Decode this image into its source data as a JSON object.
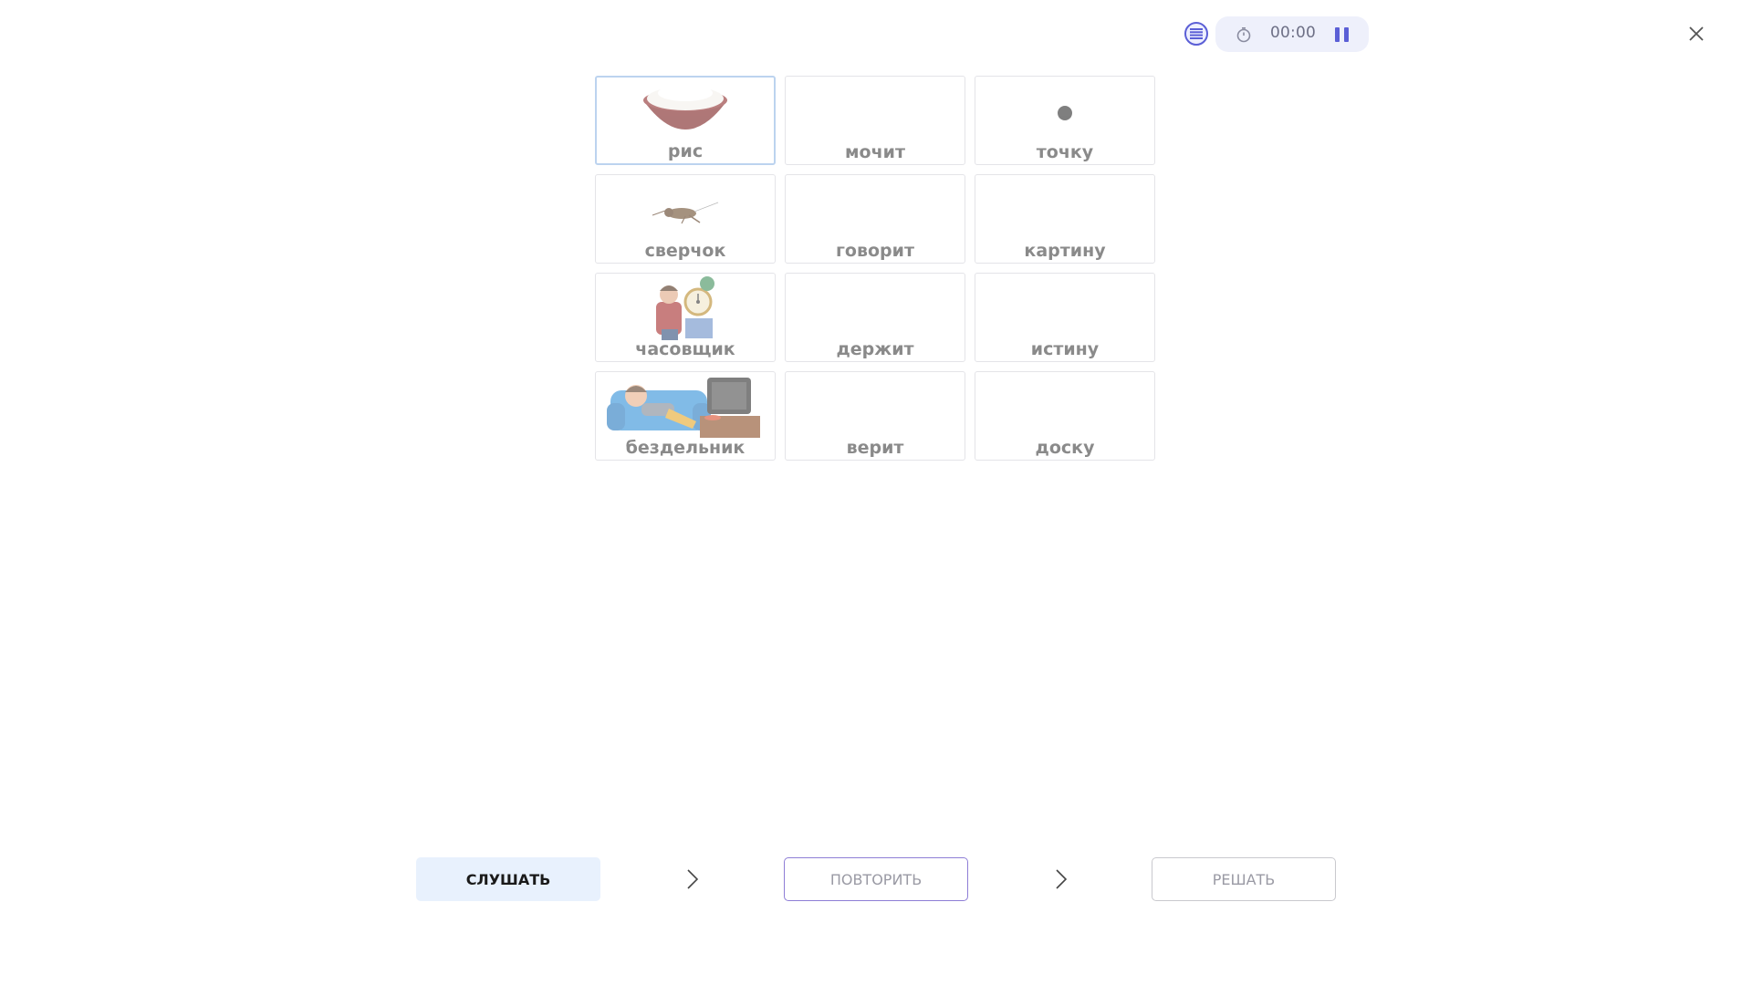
{
  "header": {
    "timer": "00:00"
  },
  "grid": {
    "rows": [
      [
        {
          "label": "рис",
          "picture": "rice-bowl",
          "selected": true
        },
        {
          "label": "мочит",
          "picture": "",
          "selected": false
        },
        {
          "label": "точку",
          "picture": "dot",
          "selected": false
        }
      ],
      [
        {
          "label": "сверчок",
          "picture": "cricket",
          "selected": false
        },
        {
          "label": "говорит",
          "picture": "",
          "selected": false
        },
        {
          "label": "картину",
          "picture": "",
          "selected": false
        }
      ],
      [
        {
          "label": "часовщик",
          "picture": "watchmaker",
          "selected": false
        },
        {
          "label": "держит",
          "picture": "",
          "selected": false
        },
        {
          "label": "истину",
          "picture": "",
          "selected": false
        }
      ],
      [
        {
          "label": "бездельник",
          "picture": "idler-on-sofa",
          "selected": false
        },
        {
          "label": "верит",
          "picture": "",
          "selected": false
        },
        {
          "label": "доску",
          "picture": "",
          "selected": false
        }
      ]
    ]
  },
  "footer": {
    "listen_label": "СЛУШАТЬ",
    "repeat_label": "ПОВТОРИТЬ",
    "solve_label": "РЕШАТЬ"
  },
  "icons": [
    "list-icon",
    "stopwatch-icon",
    "pause-icon",
    "close-icon",
    "chevron-right-icon"
  ],
  "colors": {
    "accent": "#5b5fd6",
    "listen_bg": "#e8f1fd",
    "selected_border": "#bcd3ef"
  }
}
